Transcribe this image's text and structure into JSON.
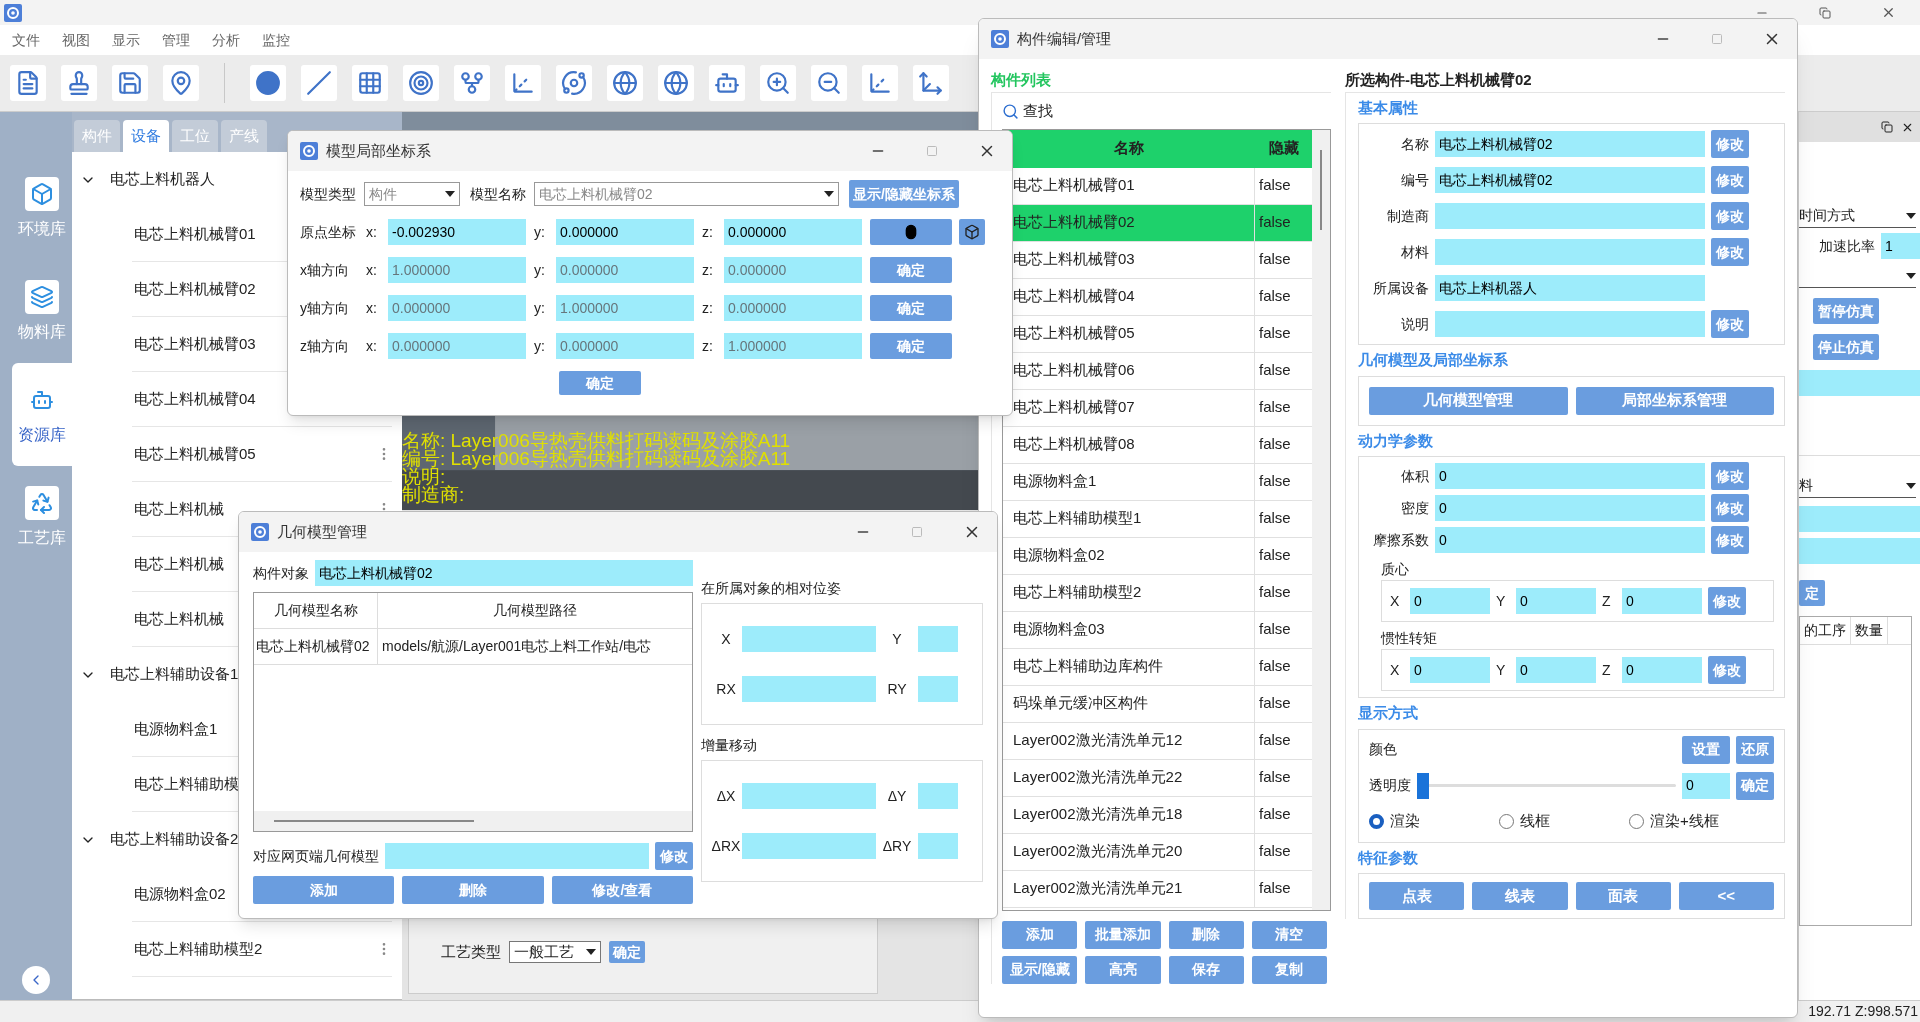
{
  "menu": [
    "文件",
    "视图",
    "显示",
    "管理",
    "分析",
    "监控"
  ],
  "sidebar": {
    "items": [
      {
        "label": "环境库",
        "selected": false
      },
      {
        "label": "物料库",
        "selected": false
      },
      {
        "label": "资源库",
        "selected": true
      },
      {
        "label": "工艺库",
        "selected": false
      }
    ]
  },
  "tree_panel": {
    "tabs": [
      {
        "label": "构件",
        "selected": false
      },
      {
        "label": "设备",
        "selected": true
      },
      {
        "label": "工位",
        "selected": false
      },
      {
        "label": "产线",
        "selected": false
      }
    ],
    "tree": [
      {
        "label": "电芯上料机器人",
        "expanded": true,
        "children": [
          {
            "label": "电芯上料机械臂01"
          },
          {
            "label": "电芯上料机械臂02"
          },
          {
            "label": "电芯上料机械臂03"
          },
          {
            "label": "电芯上料机械臂04"
          },
          {
            "label": "电芯上料机械臂05"
          },
          {
            "label": "电芯上料机械"
          },
          {
            "label": "电芯上料机械"
          },
          {
            "label": "电芯上料机械"
          }
        ]
      },
      {
        "label": "电芯上料辅助设备1",
        "expanded": true,
        "children": [
          {
            "label": "电源物料盒1"
          },
          {
            "label": "电芯上料辅助模"
          }
        ]
      },
      {
        "label": "电芯上料辅助设备2",
        "expanded": true,
        "children": [
          {
            "label": "电源物料盒02"
          },
          {
            "label": "电芯上料辅助模型2"
          }
        ]
      }
    ]
  },
  "viewport": {
    "overlay": [
      "名称: Layer006导热壳供料打码读码及涂胶A11",
      "编号: Layer006导热壳供料打码读码及涂胶A11",
      "说明:",
      "制造商:"
    ]
  },
  "process": {
    "label": "工艺类型",
    "value": "一般工艺",
    "button": "确定"
  },
  "right_panel": {
    "time_select": "时间方式",
    "rate_label": "加速比率",
    "rate_value": "1",
    "buttons": [
      "暂停仿真",
      "停止仿真"
    ],
    "material_select": "料",
    "confirm": "定",
    "columns": [
      "的工序",
      "数量"
    ]
  },
  "status_bar": {
    "coords": "192.71 Z:998.571"
  },
  "coord_dialog": {
    "title": "模型局部坐标系",
    "type_label": "模型类型",
    "type_value": "构件",
    "name_label": "模型名称",
    "name_value": "电芯上料机械臂02",
    "toggle_button": "显示/隐藏坐标系",
    "rows": [
      {
        "label": "原点坐标",
        "disabled": false,
        "axes": [
          {
            "label": "x:",
            "value": "-0.002930"
          },
          {
            "label": "y:",
            "value": "0.000000"
          },
          {
            "label": "z:",
            "value": "0.000000"
          }
        ]
      },
      {
        "label": "x轴方向",
        "disabled": true,
        "axes": [
          {
            "label": "x:",
            "value": "1.000000"
          },
          {
            "label": "y:",
            "value": "0.000000"
          },
          {
            "label": "z:",
            "value": "0.000000"
          }
        ],
        "button": "确定"
      },
      {
        "label": "y轴方向",
        "disabled": true,
        "axes": [
          {
            "label": "x:",
            "value": "0.000000"
          },
          {
            "label": "y:",
            "value": "1.000000"
          },
          {
            "label": "z:",
            "value": "0.000000"
          }
        ],
        "button": "确定"
      },
      {
        "label": "z轴方向",
        "disabled": true,
        "axes": [
          {
            "label": "x:",
            "value": "0.000000"
          },
          {
            "label": "y:",
            "value": "0.000000"
          },
          {
            "label": "z:",
            "value": "1.000000"
          }
        ],
        "button": "确定"
      }
    ],
    "ok": "确定"
  },
  "geometry_dialog": {
    "title": "几何模型管理",
    "object_label": "构件对象",
    "object_value": "电芯上料机械臂02",
    "columns": [
      "几何模型名称",
      "几何模型路径"
    ],
    "rows": [
      [
        "电芯上料机械臂02",
        "models/航源/Layer001电芯上料工作站/电芯"
      ]
    ],
    "web_label": "对应网页端几何模型",
    "web_button": "修改",
    "buttons": [
      "添加",
      "删除",
      "修改/查看"
    ],
    "pose": {
      "legend": "在所属对象的相对位姿",
      "fields": [
        "X",
        "Y",
        "RX",
        "RY"
      ]
    },
    "delta": {
      "legend": "增量移动",
      "fields": [
        "ΔX",
        "ΔY",
        "ΔRX",
        "ΔRY"
      ]
    }
  },
  "component_dialog": {
    "title": "构件编辑/管理",
    "list_legend": "构件列表",
    "search": "查找",
    "columns": [
      "名称",
      "隐藏"
    ],
    "rows": [
      {
        "name": "电芯上料机械臂01",
        "hidden": "false",
        "selected": false
      },
      {
        "name": "电芯上料机械臂02",
        "hidden": "false",
        "selected": true
      },
      {
        "name": "电芯上料机械臂03",
        "hidden": "false",
        "selected": false
      },
      {
        "name": "电芯上料机械臂04",
        "hidden": "false",
        "selected": false
      },
      {
        "name": "电芯上料机械臂05",
        "hidden": "false",
        "selected": false
      },
      {
        "name": "电芯上料机械臂06",
        "hidden": "false",
        "selected": false
      },
      {
        "name": "电芯上料机械臂07",
        "hidden": "false",
        "selected": false
      },
      {
        "name": "电芯上料机械臂08",
        "hidden": "false",
        "selected": false
      },
      {
        "name": "电源物料盒1",
        "hidden": "false",
        "selected": false
      },
      {
        "name": "电芯上料辅助模型1",
        "hidden": "false",
        "selected": false
      },
      {
        "name": "电源物料盒02",
        "hidden": "false",
        "selected": false
      },
      {
        "name": "电芯上料辅助模型2",
        "hidden": "false",
        "selected": false
      },
      {
        "name": "电源物料盒03",
        "hidden": "false",
        "selected": false
      },
      {
        "name": "电芯上料辅助边库构件",
        "hidden": "false",
        "selected": false
      },
      {
        "name": "码垛单元缓冲区构件",
        "hidden": "false",
        "selected": false
      },
      {
        "name": "Layer002激光清洗单元12",
        "hidden": "false",
        "selected": false
      },
      {
        "name": "Layer002激光清洗单元22",
        "hidden": "false",
        "selected": false
      },
      {
        "name": "Layer002激光清洗单元18",
        "hidden": "false",
        "selected": false
      },
      {
        "name": "Layer002激光清洗单元20",
        "hidden": "false",
        "selected": false
      },
      {
        "name": "Layer002激光清洗单元21",
        "hidden": "false",
        "selected": false
      }
    ],
    "list_buttons": [
      "添加",
      "批量添加",
      "删除",
      "清空",
      "显示/隐藏",
      "高亮",
      "保存",
      "复制"
    ],
    "selected_title": "所选构件-电芯上料机械臂02",
    "basic": {
      "legend": "基本属性",
      "rows": [
        {
          "label": "名称",
          "value": "电芯上料机械臂02",
          "button": "修改"
        },
        {
          "label": "编号",
          "value": "电芯上料机械臂02",
          "button": "修改"
        },
        {
          "label": "制造商",
          "button": "修改"
        },
        {
          "label": "材料",
          "button": "修改"
        },
        {
          "label": "所属设备",
          "value": "电芯上料机器人"
        },
        {
          "label": "说明",
          "button": "修改"
        }
      ]
    },
    "geometry": {
      "legend": "几何模型及局部坐标系",
      "buttons": [
        "几何模型管理",
        "局部坐标系管理"
      ]
    },
    "dynamics": {
      "legend": "动力学参数",
      "rows": [
        {
          "label": "体积",
          "value": "0",
          "button": "修改"
        },
        {
          "label": "密度",
          "value": "0",
          "button": "修改"
        },
        {
          "label": "摩擦系数",
          "value": "0",
          "button": "修改"
        }
      ],
      "groups": [
        {
          "legend": "质心",
          "fields": [
            {
              "label": "X",
              "value": "0"
            },
            {
              "label": "Y",
              "value": "0"
            },
            {
              "label": "Z",
              "value": "0"
            }
          ],
          "button": "修改"
        },
        {
          "legend": "惯性转矩",
          "fields": [
            {
              "label": "X",
              "value": "0"
            },
            {
              "label": "Y",
              "value": "0"
            },
            {
              "label": "Z",
              "value": "0"
            }
          ],
          "button": "修改"
        }
      ]
    },
    "display": {
      "legend": "显示方式",
      "color_label": "颜色",
      "color_buttons": [
        "设置",
        "还原"
      ],
      "opacity_label": "透明度",
      "opacity": {
        "level": 0
      },
      "opacity_value": "0",
      "opacity_button": "确定",
      "modes": [
        {
          "label": "渲染",
          "selected": true
        },
        {
          "label": "线框",
          "selected": false
        },
        {
          "label": "渲染+线框",
          "selected": false
        }
      ]
    },
    "features": {
      "legend": "特征参数",
      "buttons": [
        "点表",
        "线表",
        "面表",
        "<<"
      ]
    }
  }
}
